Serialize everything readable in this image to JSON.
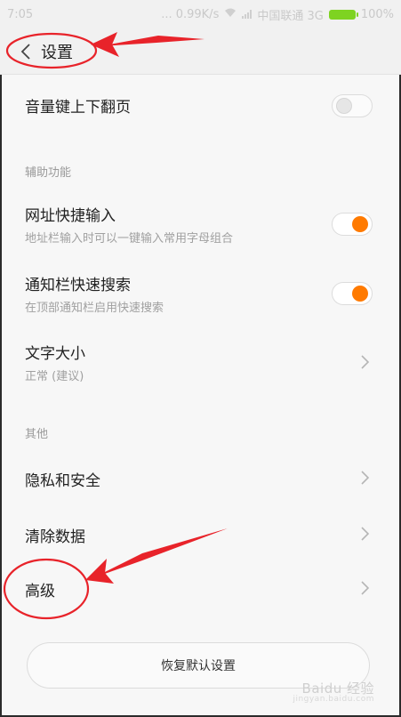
{
  "status_bar": {
    "time": "7:05",
    "speed": "... 0.99K/s",
    "carrier": "中国联通 3G",
    "battery": "100%"
  },
  "title_bar": {
    "title": "设置"
  },
  "rows": {
    "volume_page": {
      "label": "音量键上下翻页",
      "toggle": "off"
    },
    "section_accessibility": "辅助功能",
    "url_quick": {
      "label": "网址快捷输入",
      "sub": "地址栏输入时可以一键输入常用字母组合",
      "toggle": "on"
    },
    "notif_search": {
      "label": "通知栏快速搜索",
      "sub": "在顶部通知栏启用快速搜索",
      "toggle": "on"
    },
    "font_size": {
      "label": "文字大小",
      "sub": "正常 (建议)"
    },
    "section_other": "其他",
    "privacy": {
      "label": "隐私和安全"
    },
    "clear_data": {
      "label": "清除数据"
    },
    "advanced": {
      "label": "高级"
    }
  },
  "reset_button": {
    "label": "恢复默认设置"
  },
  "watermark": {
    "text": "Baidu 经验",
    "sub": "jingyan.baidu.com"
  },
  "colors": {
    "accent": "#ff7a00",
    "annotation": "#e8232a"
  }
}
